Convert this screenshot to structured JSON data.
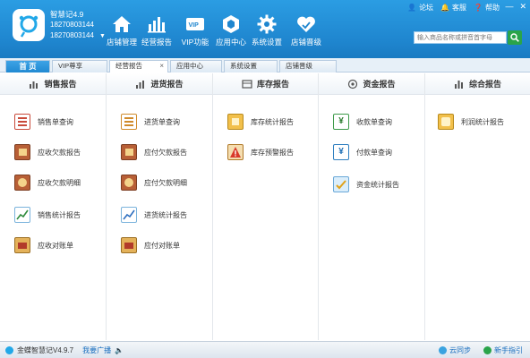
{
  "app": {
    "name": "智慧记4.9",
    "phone1": "18270803144",
    "phone2": "18270803144"
  },
  "nav": [
    {
      "label": "店铺管理",
      "icon": "home-icon"
    },
    {
      "label": "经营报告",
      "icon": "bar-chart-icon"
    },
    {
      "label": "VIP功能",
      "icon": "vip-card-icon"
    },
    {
      "label": "应用中心",
      "icon": "app-center-icon"
    },
    {
      "label": "系统设置",
      "icon": "gear-icon"
    },
    {
      "label": "店铺晋级",
      "icon": "heart-upgrade-icon"
    }
  ],
  "toplinks": {
    "forum": "论坛",
    "service": "客服",
    "help": "帮助"
  },
  "search": {
    "placeholder": "输入商品名称或拼音首字母"
  },
  "tabs": {
    "home": "首 页",
    "items": [
      "VIP尊享",
      "经营报告",
      "应用中心",
      "系统设置",
      "店铺晋级"
    ]
  },
  "columns": [
    {
      "title": "销售报告",
      "icon": "sales-report-icon",
      "items": [
        "销售单查询",
        "应收欠款报告",
        "应收欠款明细",
        "销售统计报告",
        "应收对账单"
      ]
    },
    {
      "title": "进货报告",
      "icon": "purchase-report-icon",
      "items": [
        "进货单查询",
        "应付欠款报告",
        "应付欠款明细",
        "进货统计报告",
        "应付对账单"
      ]
    },
    {
      "title": "库存报告",
      "icon": "inventory-report-icon",
      "items": [
        "库存统计报告",
        "库存预警报告"
      ]
    },
    {
      "title": "资金报告",
      "icon": "fund-report-icon",
      "items": [
        "收款单查询",
        "付款单查询",
        "资金统计报告"
      ]
    },
    {
      "title": "综合报告",
      "icon": "summary-report-icon",
      "items": [
        "利润统计报告"
      ]
    }
  ],
  "status": {
    "version": "金蝶智慧记V4.9.7",
    "broadcast": "我要广播",
    "sync": "云同步",
    "guide": "新手指引"
  },
  "colors": {
    "header": "#1f86cf",
    "accent_green": "#2aa44a"
  }
}
